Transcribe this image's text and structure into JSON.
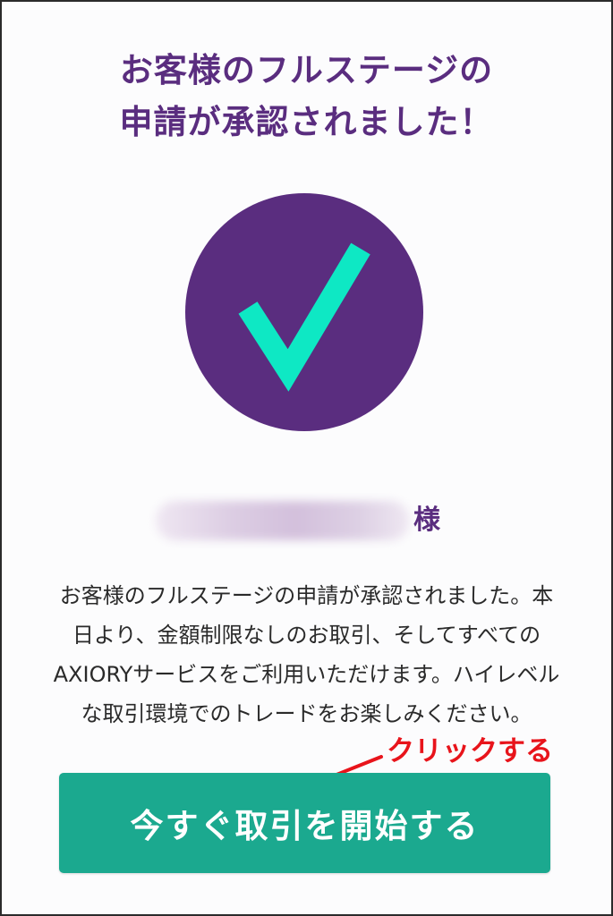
{
  "header": {
    "title_line1": "お客様のフルステージの",
    "title_line2": "申請が承認されました！"
  },
  "status_icon": {
    "name": "checkmark-icon",
    "circle_color": "#5a2d7f",
    "check_color": "#0ee8c4"
  },
  "account": {
    "honorific": "様"
  },
  "message": {
    "line1": "お客様のフルステージの申請が承認されました。本",
    "line2": "日より、金額制限なしのお取引、そしてすべての",
    "line3": "AXIORYサービスをご利用いただけます。ハイレベル",
    "line4": "な取引環境でのトレードをお楽しみください。"
  },
  "annotation": {
    "text": "クリックする",
    "color": "#e8141b"
  },
  "cta": {
    "label": "今すぐ取引を開始する",
    "color": "#1ba98f"
  }
}
